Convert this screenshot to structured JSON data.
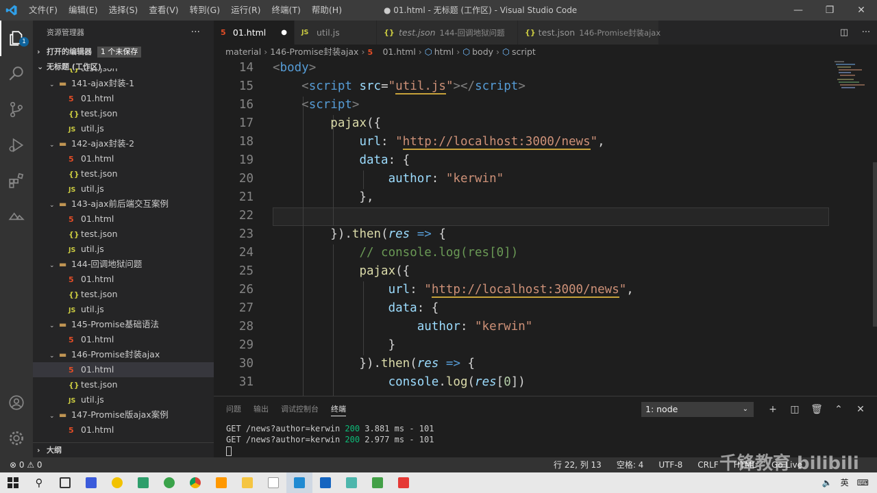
{
  "menu": [
    "文件(F)",
    "编辑(E)",
    "选择(S)",
    "查看(V)",
    "转到(G)",
    "运行(R)",
    "终端(T)",
    "帮助(H)"
  ],
  "window_title": "● 01.html - 无标题 (工作区) - Visual Studio Code",
  "activity": {
    "explorer_badge": "1"
  },
  "sidebar": {
    "title": "资源管理器",
    "open_editors": "打开的编辑器",
    "unsaved": "1 个未保存",
    "workspace": "无标题 (工作区)",
    "outline": "大纲"
  },
  "tree": [
    {
      "kind": "file",
      "icon": "json",
      "name": "test.json"
    },
    {
      "kind": "folder",
      "name": "141-ajax封装-1"
    },
    {
      "kind": "file",
      "icon": "html",
      "name": "01.html"
    },
    {
      "kind": "file",
      "icon": "json",
      "name": "test.json"
    },
    {
      "kind": "file",
      "icon": "js",
      "name": "util.js"
    },
    {
      "kind": "folder",
      "name": "142-ajax封装-2"
    },
    {
      "kind": "file",
      "icon": "html",
      "name": "01.html"
    },
    {
      "kind": "file",
      "icon": "json",
      "name": "test.json"
    },
    {
      "kind": "file",
      "icon": "js",
      "name": "util.js"
    },
    {
      "kind": "folder",
      "name": "143-ajax前后端交互案例"
    },
    {
      "kind": "file",
      "icon": "html",
      "name": "01.html"
    },
    {
      "kind": "file",
      "icon": "json",
      "name": "test.json"
    },
    {
      "kind": "file",
      "icon": "js",
      "name": "util.js"
    },
    {
      "kind": "folder",
      "name": "144-回调地狱问题"
    },
    {
      "kind": "file",
      "icon": "html",
      "name": "01.html"
    },
    {
      "kind": "file",
      "icon": "json",
      "name": "test.json"
    },
    {
      "kind": "file",
      "icon": "js",
      "name": "util.js"
    },
    {
      "kind": "folder",
      "name": "145-Promise基础语法"
    },
    {
      "kind": "file",
      "icon": "html",
      "name": "01.html"
    },
    {
      "kind": "folder",
      "name": "146-Promise封装ajax"
    },
    {
      "kind": "file",
      "icon": "html",
      "name": "01.html",
      "selected": true
    },
    {
      "kind": "file",
      "icon": "json",
      "name": "test.json"
    },
    {
      "kind": "file",
      "icon": "js",
      "name": "util.js"
    },
    {
      "kind": "folder",
      "name": "147-Promise版ajax案例"
    },
    {
      "kind": "file",
      "icon": "html",
      "name": "01.html"
    }
  ],
  "tabs": [
    {
      "icon": "html",
      "label": "01.html",
      "sub": "",
      "active": true,
      "dirty": true
    },
    {
      "icon": "js",
      "label": "util.js",
      "sub": "",
      "active": false
    },
    {
      "icon": "json",
      "label": "test.json",
      "sub": "144-回调地狱问题",
      "active": false,
      "italic": true
    },
    {
      "icon": "json",
      "label": "test.json",
      "sub": "146-Promise封装ajax",
      "active": false
    }
  ],
  "breadcrumb": [
    "material",
    "146-Promise封装ajax",
    "01.html",
    "html",
    "body",
    "script"
  ],
  "code_lines": [
    {
      "n": "14",
      "html": "<span class='t-ang'>&lt;</span><span class='t-tag'>body</span><span class='t-ang'>&gt;</span>"
    },
    {
      "n": "15",
      "html": "    <span class='t-ang'>&lt;</span><span class='t-tag'>script</span> <span class='t-attr'>src</span>=<span class='t-str'>\"<span class='ul'>util.js</span>\"</span><span class='t-ang'>&gt;&lt;/</span><span class='t-tag'>script</span><span class='t-ang'>&gt;</span>"
    },
    {
      "n": "16",
      "html": "    <span class='t-ang'>&lt;</span><span class='t-tag'>script</span><span class='t-ang'>&gt;</span>"
    },
    {
      "n": "17",
      "html": "        <span class='t-fn'>pajax</span>({"
    },
    {
      "n": "18",
      "html": "            <span class='t-attr'>url</span>: <span class='t-str'>\"<span class='ul'>http://localhost:3000/news</span>\"</span>,"
    },
    {
      "n": "19",
      "html": "            <span class='t-attr'>data</span>: {"
    },
    {
      "n": "20",
      "html": "                <span class='t-attr'>author</span>: <span class='t-str'>\"kerwin\"</span>"
    },
    {
      "n": "21",
      "html": "            },"
    },
    {
      "n": "22",
      "html": ""
    },
    {
      "n": "23",
      "html": "        }).<span class='t-fn'>then</span>(<span class='t-par'>res</span> <span class='t-kw'>=&gt;</span> {"
    },
    {
      "n": "24",
      "html": "            <span class='t-cm'>// console.log(res[0])</span>"
    },
    {
      "n": "25",
      "html": "            <span class='t-fn'>pajax</span>({"
    },
    {
      "n": "26",
      "html": "                <span class='t-attr'>url</span>: <span class='t-str'>\"<span class='ul'>http://localhost:3000/news</span>\"</span>,"
    },
    {
      "n": "27",
      "html": "                <span class='t-attr'>data</span>: {"
    },
    {
      "n": "28",
      "html": "                    <span class='t-attr'>author</span>: <span class='t-str'>\"kerwin\"</span>"
    },
    {
      "n": "29",
      "html": "                }"
    },
    {
      "n": "30",
      "html": "            }).<span class='t-fn'>then</span>(<span class='t-par'>res</span> <span class='t-kw'>=&gt;</span> {"
    },
    {
      "n": "31",
      "html": "                <span class='t-attr'>console</span>.<span class='t-fn'>log</span>(<span class='t-par'>res</span>[<span class='t-num'>0</span>])"
    }
  ],
  "panel": {
    "tabs": [
      "问题",
      "输出",
      "调试控制台",
      "终端"
    ],
    "active_tab": "终端",
    "terminal_select": "1: node",
    "lines": [
      {
        "pre": "GET /news?author=kerwin ",
        "code": "200",
        "post": " 3.881 ms - 101"
      },
      {
        "pre": "GET /news?author=kerwin ",
        "code": "200",
        "post": " 2.977 ms - 101"
      }
    ]
  },
  "status": {
    "problems": "⊗ 0 ⚠ 0",
    "position": "行 22, 列 13",
    "indent": "空格: 4",
    "encoding": "UTF-8",
    "eol": "CRLF",
    "language": "HTML",
    "extra": "Go Live"
  },
  "watermark": "千锋教育 bilibili",
  "taskbar": {
    "ime": "英"
  }
}
